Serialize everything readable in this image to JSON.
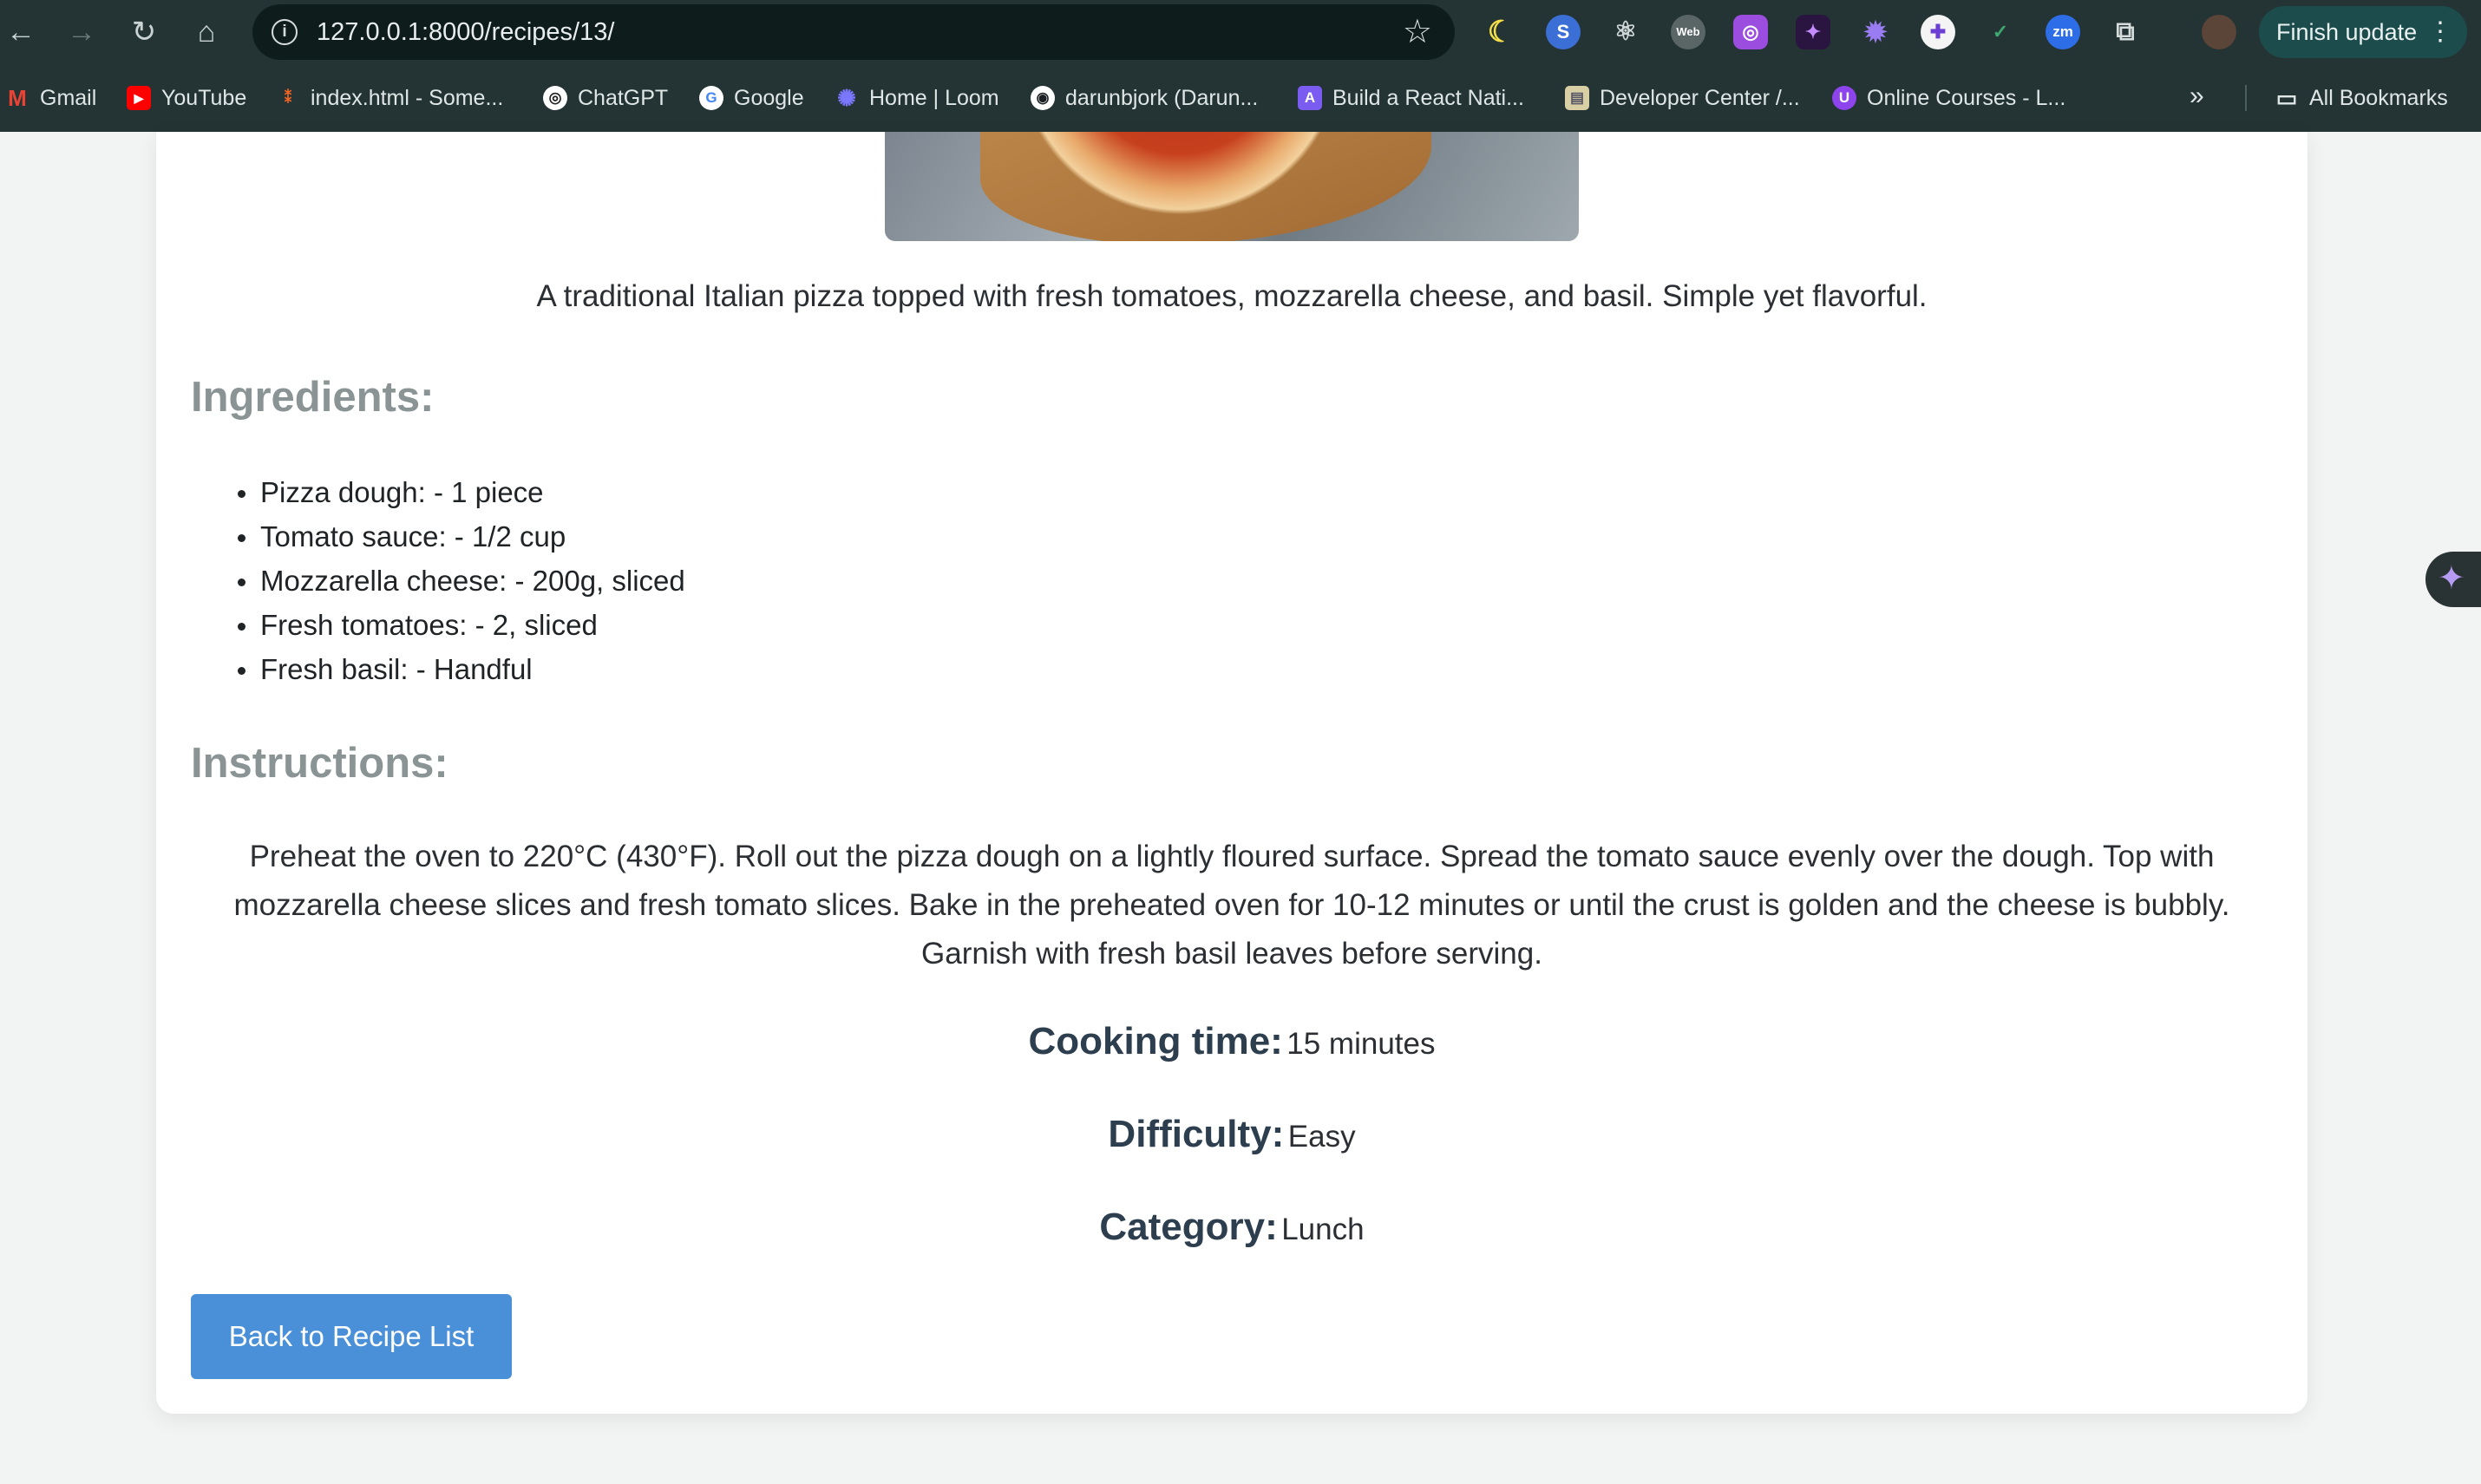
{
  "browser": {
    "url": "127.0.0.1:8000/recipes/13/",
    "finish_update": "Finish update",
    "bookmarks": [
      {
        "label": "Gmail",
        "icon": "gmail-icon",
        "color": "#ea4335"
      },
      {
        "label": "YouTube",
        "icon": "youtube-icon",
        "color": "#ff0000"
      },
      {
        "label": "index.html - Some...",
        "icon": "codesandbox-icon",
        "color": "#f26522"
      },
      {
        "label": "ChatGPT",
        "icon": "chatgpt-icon",
        "color": "#ffffff"
      },
      {
        "label": "Google",
        "icon": "google-icon",
        "color": "#4285f4"
      },
      {
        "label": "Home | Loom",
        "icon": "loom-icon",
        "color": "#625df5"
      },
      {
        "label": "darunbjork (Darun...",
        "icon": "github-icon",
        "color": "#ffffff"
      },
      {
        "label": "Build a React Nati...",
        "icon": "rocket-icon",
        "color": "#7b5cf0"
      },
      {
        "label": "Developer Center /...",
        "icon": "doc-icon",
        "color": "#d9cfa5"
      },
      {
        "label": "Online Courses - L...",
        "icon": "course-icon",
        "color": "#8e44ec"
      }
    ],
    "all_bookmarks": "All Bookmarks"
  },
  "recipe": {
    "description": "A traditional Italian pizza topped with fresh tomatoes, mozzarella cheese, and basil. Simple yet flavorful.",
    "ingredients_title": "Ingredients:",
    "ingredients": [
      "Pizza dough: - 1 piece",
      "Tomato sauce: - 1/2 cup",
      "Mozzarella cheese: - 200g, sliced",
      "Fresh tomatoes: - 2, sliced",
      "Fresh basil: - Handful"
    ],
    "instructions_title": "Instructions:",
    "instructions": "Preheat the oven to 220°C (430°F). Roll out the pizza dough on a lightly floured surface. Spread the tomato sauce evenly over the dough. Top with mozzarella cheese slices and fresh tomato slices. Bake in the preheated oven for 10-12 minutes or until the crust is golden and the cheese is bubbly. Garnish with fresh basil leaves before serving.",
    "cooking_time_label": "Cooking time:",
    "cooking_time": "15 minutes",
    "difficulty_label": "Difficulty:",
    "difficulty": "Easy",
    "category_label": "Category:",
    "category": "Lunch",
    "back_button": "Back to Recipe List"
  },
  "colors": {
    "accent": "#4a90d9",
    "heading": "#8a9494",
    "chrome": "#243434"
  }
}
